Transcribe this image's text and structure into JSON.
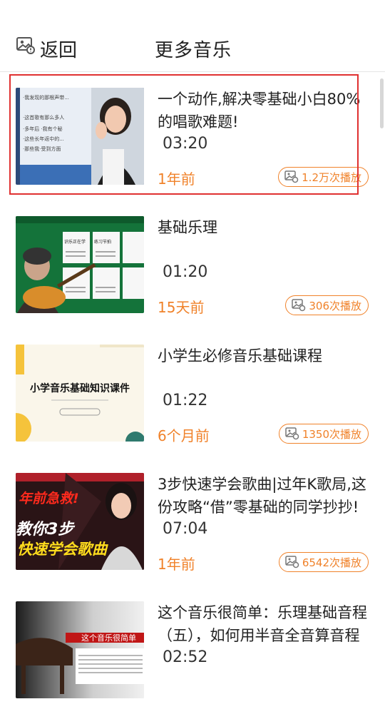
{
  "header": {
    "back_label": "返回",
    "title": "更多音乐",
    "back_icon": "image-icon"
  },
  "videos": [
    {
      "title": "一个动作,解决零基础小白80%的唱歌难题!",
      "duration": "03:20",
      "age": "1年前",
      "plays": "1.2万次播放",
      "selected": true,
      "thumb_text": [
        "·我发现的那根声带...",
        "·这首歌有那么多人",
        "·多年后 ·我有个秘",
        "·这些长年返中的...",
        "·那些我·受到方面"
      ]
    },
    {
      "title": "基础乐理",
      "duration": "01:20",
      "age": "15天前",
      "plays": "306次播放",
      "thumb_text": [
        "识乐正在学",
        "练习节拍"
      ]
    },
    {
      "title": "小学生必修音乐基础课程",
      "duration": "01:22",
      "age": "6个月前",
      "plays": "1350次播放",
      "thumb_text": [
        "小学音乐基础知识课件"
      ]
    },
    {
      "title": "3步快速学会歌曲|过年K歌局,这份攻略“借”零基础的同学抄抄!",
      "duration": "07:04",
      "age": "1年前",
      "plays": "6542次播放",
      "thumb_text": [
        "年前急救!",
        "教你3步",
        "快速学会歌曲"
      ]
    },
    {
      "title": "这个音乐很简单：乐理基础音程（五），如何用半音全音算音程",
      "duration": "02:52",
      "age": "",
      "plays": "",
      "thumb_text": [
        "这个音乐很简单"
      ]
    }
  ],
  "colors": {
    "accent": "#f0822a",
    "highlight": "#e03131"
  }
}
